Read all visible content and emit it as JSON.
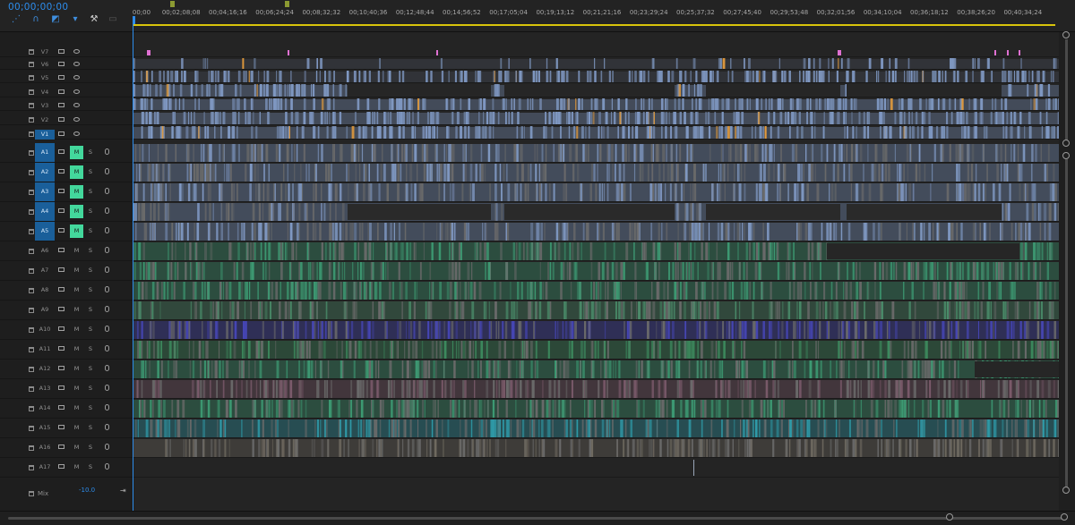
{
  "timecode": "00;00;00;00",
  "toolbar_icons": [
    "snap-icon",
    "magnet-icon",
    "linked-selection-icon",
    "add-marker-icon",
    "wrench-icon",
    "captions-icon"
  ],
  "ruler_labels": [
    "00;00",
    "00;02;08;08",
    "00;04;16;16",
    "00;06;24;24",
    "00;08;32;32",
    "00;10;40;36",
    "00;12;48;44",
    "00;14;56;52",
    "00;17;05;04",
    "00;19;13;12",
    "00;21;21;16",
    "00;23;29;24",
    "00;25;37;32",
    "00;27;45;40",
    "00;29;53;48",
    "00;32;01;56",
    "00;34;10;04",
    "00;36;18;12",
    "00;38;26;20",
    "00;40;34;24"
  ],
  "video_tracks": [
    {
      "name": "V7",
      "selected": false
    },
    {
      "name": "V6",
      "selected": false
    },
    {
      "name": "V5",
      "selected": false
    },
    {
      "name": "V4",
      "selected": false
    },
    {
      "name": "V3",
      "selected": false
    },
    {
      "name": "V2",
      "selected": false
    },
    {
      "name": "V1",
      "selected": true
    }
  ],
  "audio_tracks": [
    {
      "name": "A1",
      "selected": true,
      "m": "M",
      "m_on": true,
      "s": "S"
    },
    {
      "name": "A2",
      "selected": true,
      "m": "M",
      "m_on": true,
      "s": "S"
    },
    {
      "name": "A3",
      "selected": true,
      "m": "M",
      "m_on": true,
      "s": "S"
    },
    {
      "name": "A4",
      "selected": true,
      "m": "M",
      "m_on": true,
      "s": "S"
    },
    {
      "name": "A5",
      "selected": true,
      "m": "M",
      "m_on": true,
      "s": "S"
    },
    {
      "name": "A6",
      "selected": false,
      "m": "M",
      "m_on": false,
      "s": "S"
    },
    {
      "name": "A7",
      "selected": false,
      "m": "M",
      "m_on": false,
      "s": "S"
    },
    {
      "name": "A8",
      "selected": false,
      "m": "M",
      "m_on": false,
      "s": "S"
    },
    {
      "name": "A9",
      "selected": false,
      "m": "M",
      "m_on": false,
      "s": "S"
    },
    {
      "name": "A10",
      "selected": false,
      "m": "M",
      "m_on": false,
      "s": "S"
    },
    {
      "name": "A11",
      "selected": false,
      "m": "M",
      "m_on": false,
      "s": "S"
    },
    {
      "name": "A12",
      "selected": false,
      "m": "M",
      "m_on": false,
      "s": "S"
    },
    {
      "name": "A13",
      "selected": false,
      "m": "M",
      "m_on": false,
      "s": "S"
    },
    {
      "name": "A14",
      "selected": false,
      "m": "M",
      "m_on": false,
      "s": "S"
    },
    {
      "name": "A15",
      "selected": false,
      "m": "M",
      "m_on": false,
      "s": "S"
    },
    {
      "name": "A16",
      "selected": false,
      "m": "M",
      "m_on": false,
      "s": "S"
    },
    {
      "name": "A17",
      "selected": false,
      "m": "M",
      "m_on": false,
      "s": "S"
    }
  ],
  "mix": {
    "label": "Mix",
    "value": "-10.0",
    "end_icon": "⇥"
  },
  "colors": {
    "accent": "#2d8ceb",
    "track_selected": "#1a5f9a",
    "mute_on": "#43d89c",
    "video_clip": "#7f98c2",
    "video_highlight": "#e39b3c",
    "marker": "#e070d2",
    "work_area": "#d8c40b"
  },
  "audio_clip_colors": [
    "#7f98c2",
    "#7f98c2",
    "#7f98c2",
    "#7f98c2",
    "#7f98c2",
    "#3d9a73",
    "#3d9a73",
    "#3d9a73",
    "#4a8c6a",
    "#4646b4",
    "#3d8c5f",
    "#3d9a73",
    "#7a5a6a",
    "#3d9a73",
    "#2f9aa8",
    "#6f6a60",
    "#262626"
  ]
}
